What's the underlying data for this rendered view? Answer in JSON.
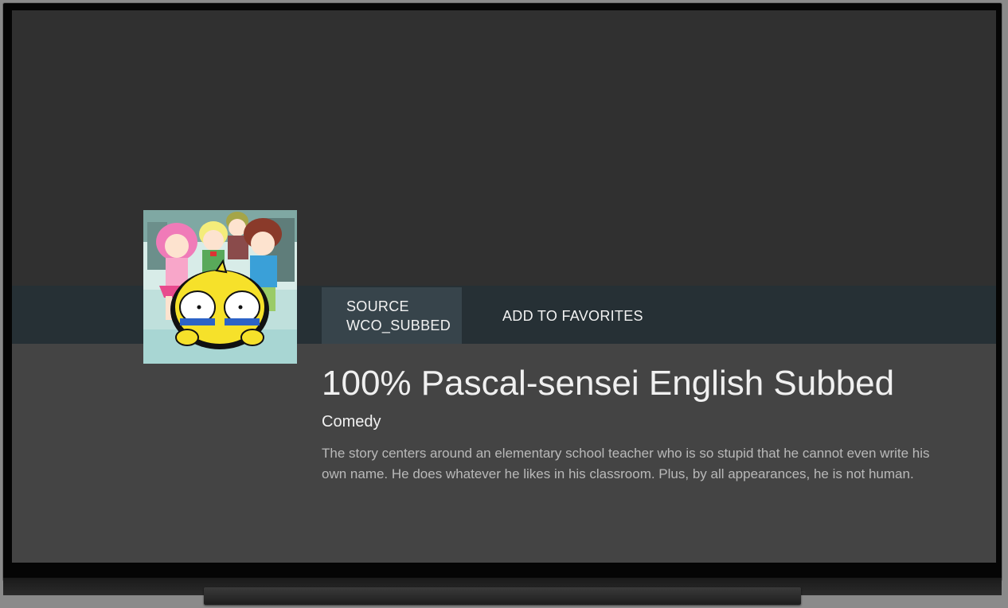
{
  "actions": {
    "source_label_line1": "SOURCE",
    "source_label_line2": "WCO_SUBBED",
    "favorites_label": "ADD TO FAVORITES"
  },
  "details": {
    "title": "100% Pascal-sensei English Subbed",
    "genre": "Comedy",
    "description": "The story centers around an elementary school teacher who is so stupid that he cannot even write his own name. He does whatever he likes in his classroom. Plus, by all appearances, he is not human."
  },
  "colors": {
    "backdrop": "#303030",
    "action_bar": "#263035",
    "focused_action": "#37444b",
    "details_bg": "#444444"
  },
  "icons": {
    "poster": "anime-cover-art-image"
  }
}
